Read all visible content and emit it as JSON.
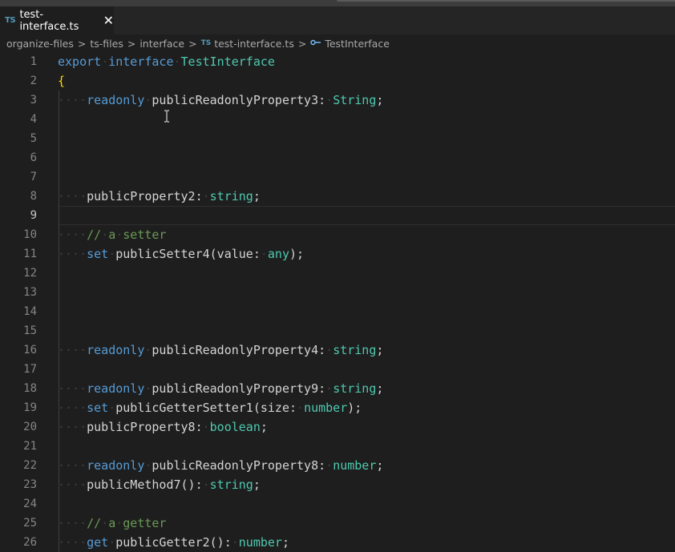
{
  "tab": {
    "badge": "TS",
    "title": "test-interface.ts",
    "close": "✕"
  },
  "breadcrumbs": {
    "items": [
      "organize-files",
      "ts-files",
      "interface"
    ],
    "file_badge": "TS",
    "file": "test-interface.ts",
    "symbol": "TestInterface",
    "separator": ">"
  },
  "lines": [
    {
      "n": "1",
      "indent": 0,
      "tokens": [
        [
          "kw",
          "export"
        ],
        [
          "ws",
          "·"
        ],
        [
          "kw",
          "interface"
        ],
        [
          "ws",
          "·"
        ],
        [
          "ty",
          "TestInterface"
        ]
      ]
    },
    {
      "n": "2",
      "indent": 0,
      "tokens": [
        [
          "br",
          "{"
        ]
      ]
    },
    {
      "n": "3",
      "indent": 1,
      "tokens": [
        [
          "kw",
          "readonly"
        ],
        [
          "ws",
          "·"
        ],
        [
          "id",
          "publicReadonlyProperty3:"
        ],
        [
          "ws",
          "·"
        ],
        [
          "ty",
          "String"
        ],
        [
          "id",
          ";"
        ]
      ]
    },
    {
      "n": "4",
      "indent": 1,
      "tokens": []
    },
    {
      "n": "5",
      "indent": 1,
      "tokens": []
    },
    {
      "n": "6",
      "indent": 1,
      "tokens": []
    },
    {
      "n": "7",
      "indent": 1,
      "tokens": []
    },
    {
      "n": "8",
      "indent": 1,
      "tokens": [
        [
          "id",
          "publicProperty2:"
        ],
        [
          "ws",
          "·"
        ],
        [
          "ty",
          "string"
        ],
        [
          "id",
          ";"
        ]
      ]
    },
    {
      "n": "9",
      "indent": 1,
      "tokens": [],
      "current": true
    },
    {
      "n": "10",
      "indent": 1,
      "tokens": [
        [
          "cm",
          "//"
        ],
        [
          "ws",
          "·"
        ],
        [
          "cm",
          "a"
        ],
        [
          "ws",
          "·"
        ],
        [
          "cm",
          "setter"
        ]
      ]
    },
    {
      "n": "11",
      "indent": 1,
      "tokens": [
        [
          "kw",
          "set"
        ],
        [
          "ws",
          "·"
        ],
        [
          "id",
          "publicSetter4(value:"
        ],
        [
          "ws",
          "·"
        ],
        [
          "ty",
          "any"
        ],
        [
          "id",
          ");"
        ]
      ]
    },
    {
      "n": "12",
      "indent": 1,
      "tokens": []
    },
    {
      "n": "13",
      "indent": 1,
      "tokens": []
    },
    {
      "n": "14",
      "indent": 1,
      "tokens": []
    },
    {
      "n": "15",
      "indent": 1,
      "tokens": []
    },
    {
      "n": "16",
      "indent": 1,
      "tokens": [
        [
          "kw",
          "readonly"
        ],
        [
          "ws",
          "·"
        ],
        [
          "id",
          "publicReadonlyProperty4:"
        ],
        [
          "ws",
          "·"
        ],
        [
          "ty",
          "string"
        ],
        [
          "id",
          ";"
        ]
      ]
    },
    {
      "n": "17",
      "indent": 1,
      "tokens": []
    },
    {
      "n": "18",
      "indent": 1,
      "tokens": [
        [
          "kw",
          "readonly"
        ],
        [
          "ws",
          "·"
        ],
        [
          "id",
          "publicReadonlyProperty9:"
        ],
        [
          "ws",
          "·"
        ],
        [
          "ty",
          "string"
        ],
        [
          "id",
          ";"
        ]
      ]
    },
    {
      "n": "19",
      "indent": 1,
      "tokens": [
        [
          "kw",
          "set"
        ],
        [
          "ws",
          "·"
        ],
        [
          "id",
          "publicGetterSetter1(size:"
        ],
        [
          "ws",
          "·"
        ],
        [
          "ty",
          "number"
        ],
        [
          "id",
          ");"
        ]
      ]
    },
    {
      "n": "20",
      "indent": 1,
      "tokens": [
        [
          "id",
          "publicProperty8:"
        ],
        [
          "ws",
          "·"
        ],
        [
          "ty",
          "boolean"
        ],
        [
          "id",
          ";"
        ]
      ]
    },
    {
      "n": "21",
      "indent": 1,
      "tokens": []
    },
    {
      "n": "22",
      "indent": 1,
      "tokens": [
        [
          "kw",
          "readonly"
        ],
        [
          "ws",
          "·"
        ],
        [
          "id",
          "publicReadonlyProperty8:"
        ],
        [
          "ws",
          "·"
        ],
        [
          "ty",
          "number"
        ],
        [
          "id",
          ";"
        ]
      ]
    },
    {
      "n": "23",
      "indent": 1,
      "tokens": [
        [
          "id",
          "publicMethod7():"
        ],
        [
          "ws",
          "·"
        ],
        [
          "ty",
          "string"
        ],
        [
          "id",
          ";"
        ]
      ]
    },
    {
      "n": "24",
      "indent": 1,
      "tokens": []
    },
    {
      "n": "25",
      "indent": 1,
      "tokens": [
        [
          "cm",
          "//"
        ],
        [
          "ws",
          "·"
        ],
        [
          "cm",
          "a"
        ],
        [
          "ws",
          "·"
        ],
        [
          "cm",
          "getter"
        ]
      ]
    },
    {
      "n": "26",
      "indent": 1,
      "tokens": [
        [
          "kw",
          "get"
        ],
        [
          "ws",
          "·"
        ],
        [
          "id",
          "publicGetter2():"
        ],
        [
          "ws",
          "·"
        ],
        [
          "ty",
          "number"
        ],
        [
          "id",
          ";"
        ]
      ]
    }
  ],
  "indent_dots": "····",
  "icons": {
    "mouse_cursor": "text-cursor-icon",
    "interface_symbol": "interface-symbol-icon",
    "close": "close-icon"
  },
  "colors": {
    "keyword": "#569cd6",
    "type": "#4ec9b0",
    "comment": "#6a9955",
    "bracket": "#ffd700",
    "line_number": "#858585"
  }
}
